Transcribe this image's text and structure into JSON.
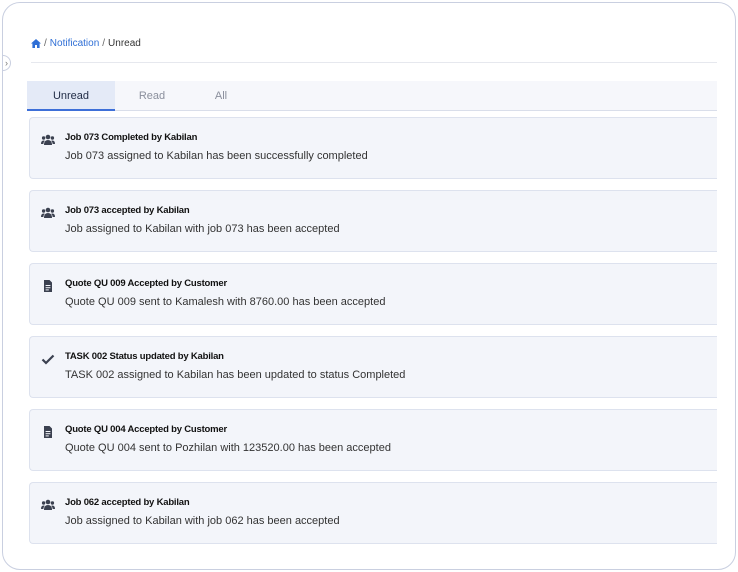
{
  "breadcrumb": {
    "home_icon": "home-icon",
    "items": [
      "Notification",
      "Unread"
    ],
    "separator": "/"
  },
  "tabs": [
    {
      "label": "Unread",
      "active": true
    },
    {
      "label": "Read",
      "active": false
    },
    {
      "label": "All",
      "active": false
    }
  ],
  "notifications": [
    {
      "icon": "users-icon",
      "title": "Job 073 Completed by Kabilan",
      "body": "Job 073 assigned to Kabilan has been successfully completed"
    },
    {
      "icon": "users-icon",
      "title": "Job 073 accepted by Kabilan",
      "body": "Job assigned to Kabilan with job 073 has been accepted"
    },
    {
      "icon": "document-icon",
      "title": "Quote QU 009 Accepted by Customer",
      "body": "Quote QU 009 sent to Kamalesh with 8760.00 has been accepted"
    },
    {
      "icon": "check-icon",
      "title": "TASK 002 Status updated by Kabilan",
      "body": "TASK 002 assigned to Kabilan has been updated to status Completed"
    },
    {
      "icon": "document-icon",
      "title": "Quote QU 004 Accepted by Customer",
      "body": "Quote QU 004 sent to Pozhilan with 123520.00 has been accepted"
    },
    {
      "icon": "users-icon",
      "title": "Job 062 accepted by Kabilan",
      "body": "Job assigned to Kabilan with job 062 has been accepted"
    }
  ],
  "colors": {
    "accent": "#3d6fd8",
    "link": "#2f6fd6",
    "card_bg": "#f3f5fa",
    "active_tab_bg": "#e4eaf7"
  }
}
